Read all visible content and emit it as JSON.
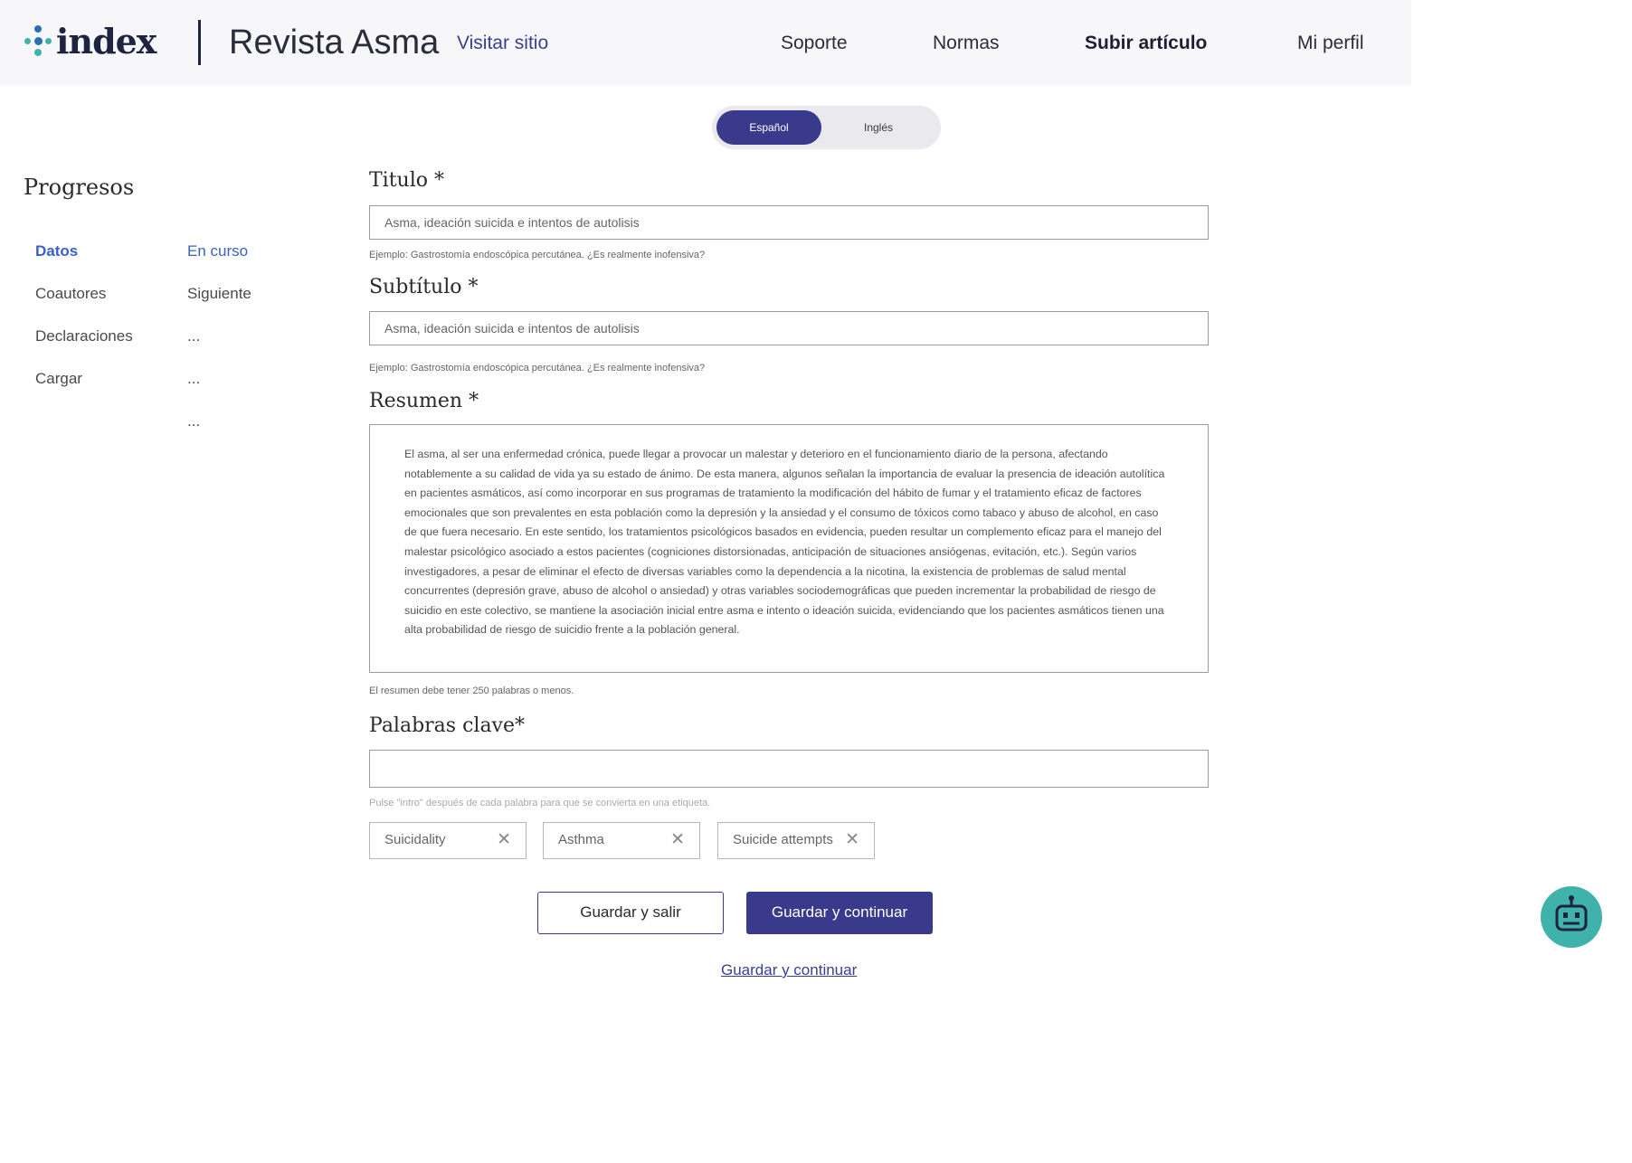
{
  "header": {
    "logo_text": "index",
    "journal_name": "Revista Asma",
    "visit_link": "Visitar sitio",
    "nav": [
      {
        "label": "Soporte"
      },
      {
        "label": "Normas"
      },
      {
        "label": "Subir artículo"
      },
      {
        "label": "Mi perfil"
      }
    ]
  },
  "language_toggle": {
    "active": "Español",
    "inactive": "Inglés"
  },
  "sidebar": {
    "title": "Progresos",
    "steps": [
      {
        "name": "Datos",
        "status": "En curso"
      },
      {
        "name": "Coautores",
        "status": "Siguiente"
      },
      {
        "name": "Declaraciones",
        "status": "..."
      },
      {
        "name": "Cargar",
        "status": "..."
      },
      {
        "name": "",
        "status": "..."
      }
    ]
  },
  "form": {
    "title": {
      "label": "Titulo *",
      "value": "Asma, ideación suicida e intentos de autolisis",
      "hint": "Ejemplo: Gastrostomía endoscópica percutánea. ¿Es realmente inofensiva?"
    },
    "subtitle": {
      "label": "Subtítulo *",
      "value": "Asma, ideación suicida e intentos de autolisis",
      "hint": "Ejemplo: Gastrostomía endoscópica percutánea. ¿Es realmente inofensiva?"
    },
    "abstract": {
      "label": "Resumen *",
      "value": "El asma, al ser una enfermedad crónica, puede llegar a provocar un malestar y deterioro en el funcionamiento diario de la persona, afectando notablemente a su calidad de vida ya su estado de ánimo. De esta manera, algunos señalan la importancia de evaluar la presencia de ideación autolítica en pacientes asmáticos, así como incorporar en sus programas de tratamiento la modificación del hábito de fumar y el tratamiento eficaz de factores emocionales que son prevalentes en esta población como la depresión y la ansiedad y el consumo de tóxicos como tabaco y abuso de alcohol, en caso de que fuera necesario. En este sentido, los tratamientos psicológicos basados en evidencia, pueden resultar un complemento eficaz para el manejo del malestar psicológico asociado a estos pacientes (cogniciones distorsionadas, anticipación de situaciones ansiógenas, evitación, etc.). Según varios investigadores, a pesar de eliminar el efecto de diversas variables como la dependencia a la nicotina, la existencia de problemas de salud mental concurrentes (depresión grave, abuso de alcohol o ansiedad) y otras variables sociodemográficas que pueden incrementar la probabilidad de riesgo de suicidio en este colectivo, se mantiene la asociación inicial entre asma e intento o ideación suicida, evidenciando que los pacientes asmáticos tienen una alta probabilidad de riesgo de suicidio frente a la población general.",
      "hint": "El resumen debe tener 250 palabras o menos."
    },
    "keywords": {
      "label": "Palabras clave*",
      "value": "",
      "hint": "Pulse \"intro\" después de cada palabra para que se convierta en una etiqueta.",
      "tags": [
        "Suicidality",
        "Asthma",
        "Suicide attempts"
      ]
    },
    "buttons": {
      "save_exit": "Guardar y salir",
      "save_continue": "Guardar y continuar",
      "link": "Guardar y continuar"
    }
  },
  "colors": {
    "primary": "#3a3a8c",
    "link": "#3a3f94",
    "active_step": "#3a62c4",
    "bot": "#3fb3ab"
  },
  "icons": {
    "logo": "index-dots-logo",
    "tag_remove": "close-icon",
    "assistant": "robot-icon"
  }
}
